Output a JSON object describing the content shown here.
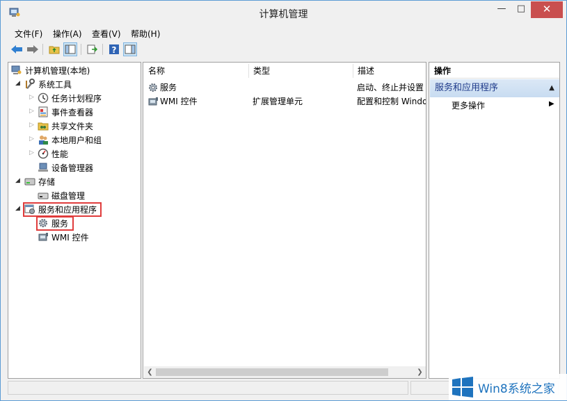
{
  "window": {
    "title": "计算机管理",
    "min_glyph": "—",
    "max_glyph": "□",
    "close_glyph": "✕"
  },
  "menu": [
    {
      "label": "文件(F)"
    },
    {
      "label": "操作(A)"
    },
    {
      "label": "查看(V)"
    },
    {
      "label": "帮助(H)"
    }
  ],
  "toolbar": {
    "icons": [
      "back-icon",
      "forward-icon",
      "up-folder-icon",
      "show-hide-tree-icon",
      "export-list-icon",
      "help-icon",
      "show-hide-action-pane-icon"
    ]
  },
  "tree": {
    "root": "计算机管理(本地)",
    "system_tools": "系统工具",
    "task_scheduler": "任务计划程序",
    "event_viewer": "事件查看器",
    "shared_folders": "共享文件夹",
    "local_users": "本地用户和组",
    "performance": "性能",
    "device_manager": "设备管理器",
    "storage": "存储",
    "disk_management": "磁盘管理",
    "services_apps": "服务和应用程序",
    "services": "服务",
    "wmi": "WMI 控件"
  },
  "list": {
    "columns": [
      "名称",
      "类型",
      "描述"
    ],
    "rows": [
      {
        "name": "服务",
        "type": "",
        "desc": "启动、终止并设置"
      },
      {
        "name": "WMI 控件",
        "type": "扩展管理单元",
        "desc": "配置和控制 Windo"
      }
    ]
  },
  "actions": {
    "header": "操作",
    "section": "服务和应用程序",
    "more": "更多操作"
  },
  "watermark": {
    "text": "Win8系统之家"
  },
  "colors": {
    "accent": "#1e73be",
    "highlight": "#e03c3c",
    "close": "#c94f4f"
  }
}
